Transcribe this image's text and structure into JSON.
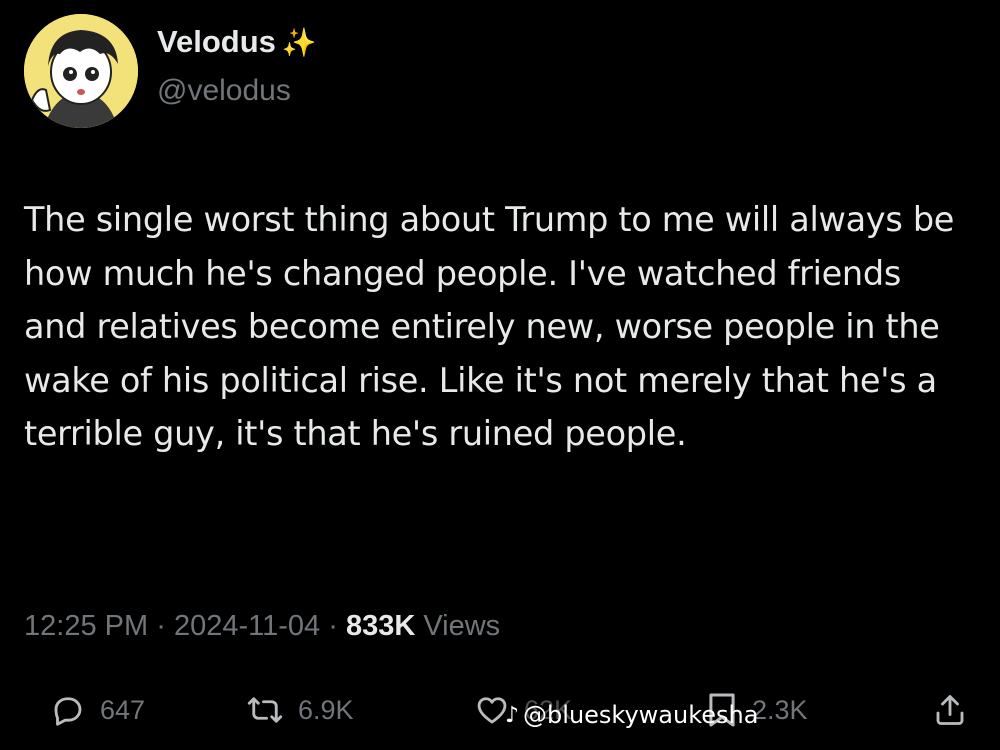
{
  "tweet": {
    "display_name": "Velodus",
    "handle": "@velodus",
    "text": "The single worst thing about Trump to me will always be how much he's changed people. I've watched friends and relatives become entirely new, worse people in the wake of his political rise. Like it's not merely that he's a terrible guy, it's that he's ruined people.",
    "time": "12:25 PM",
    "separator": "·",
    "date": "2024-11-04",
    "views_count": "833K",
    "views_label": "Views"
  },
  "actions": {
    "replies": "647",
    "reposts": "6.9K",
    "likes": "62K",
    "bookmarks": "2.3K"
  },
  "watermark": {
    "text": "@blueskywaukesha"
  },
  "colors": {
    "background": "#000000",
    "text": "#e7e9ea",
    "secondary": "#71767b",
    "sparkle": "#f5c518"
  }
}
